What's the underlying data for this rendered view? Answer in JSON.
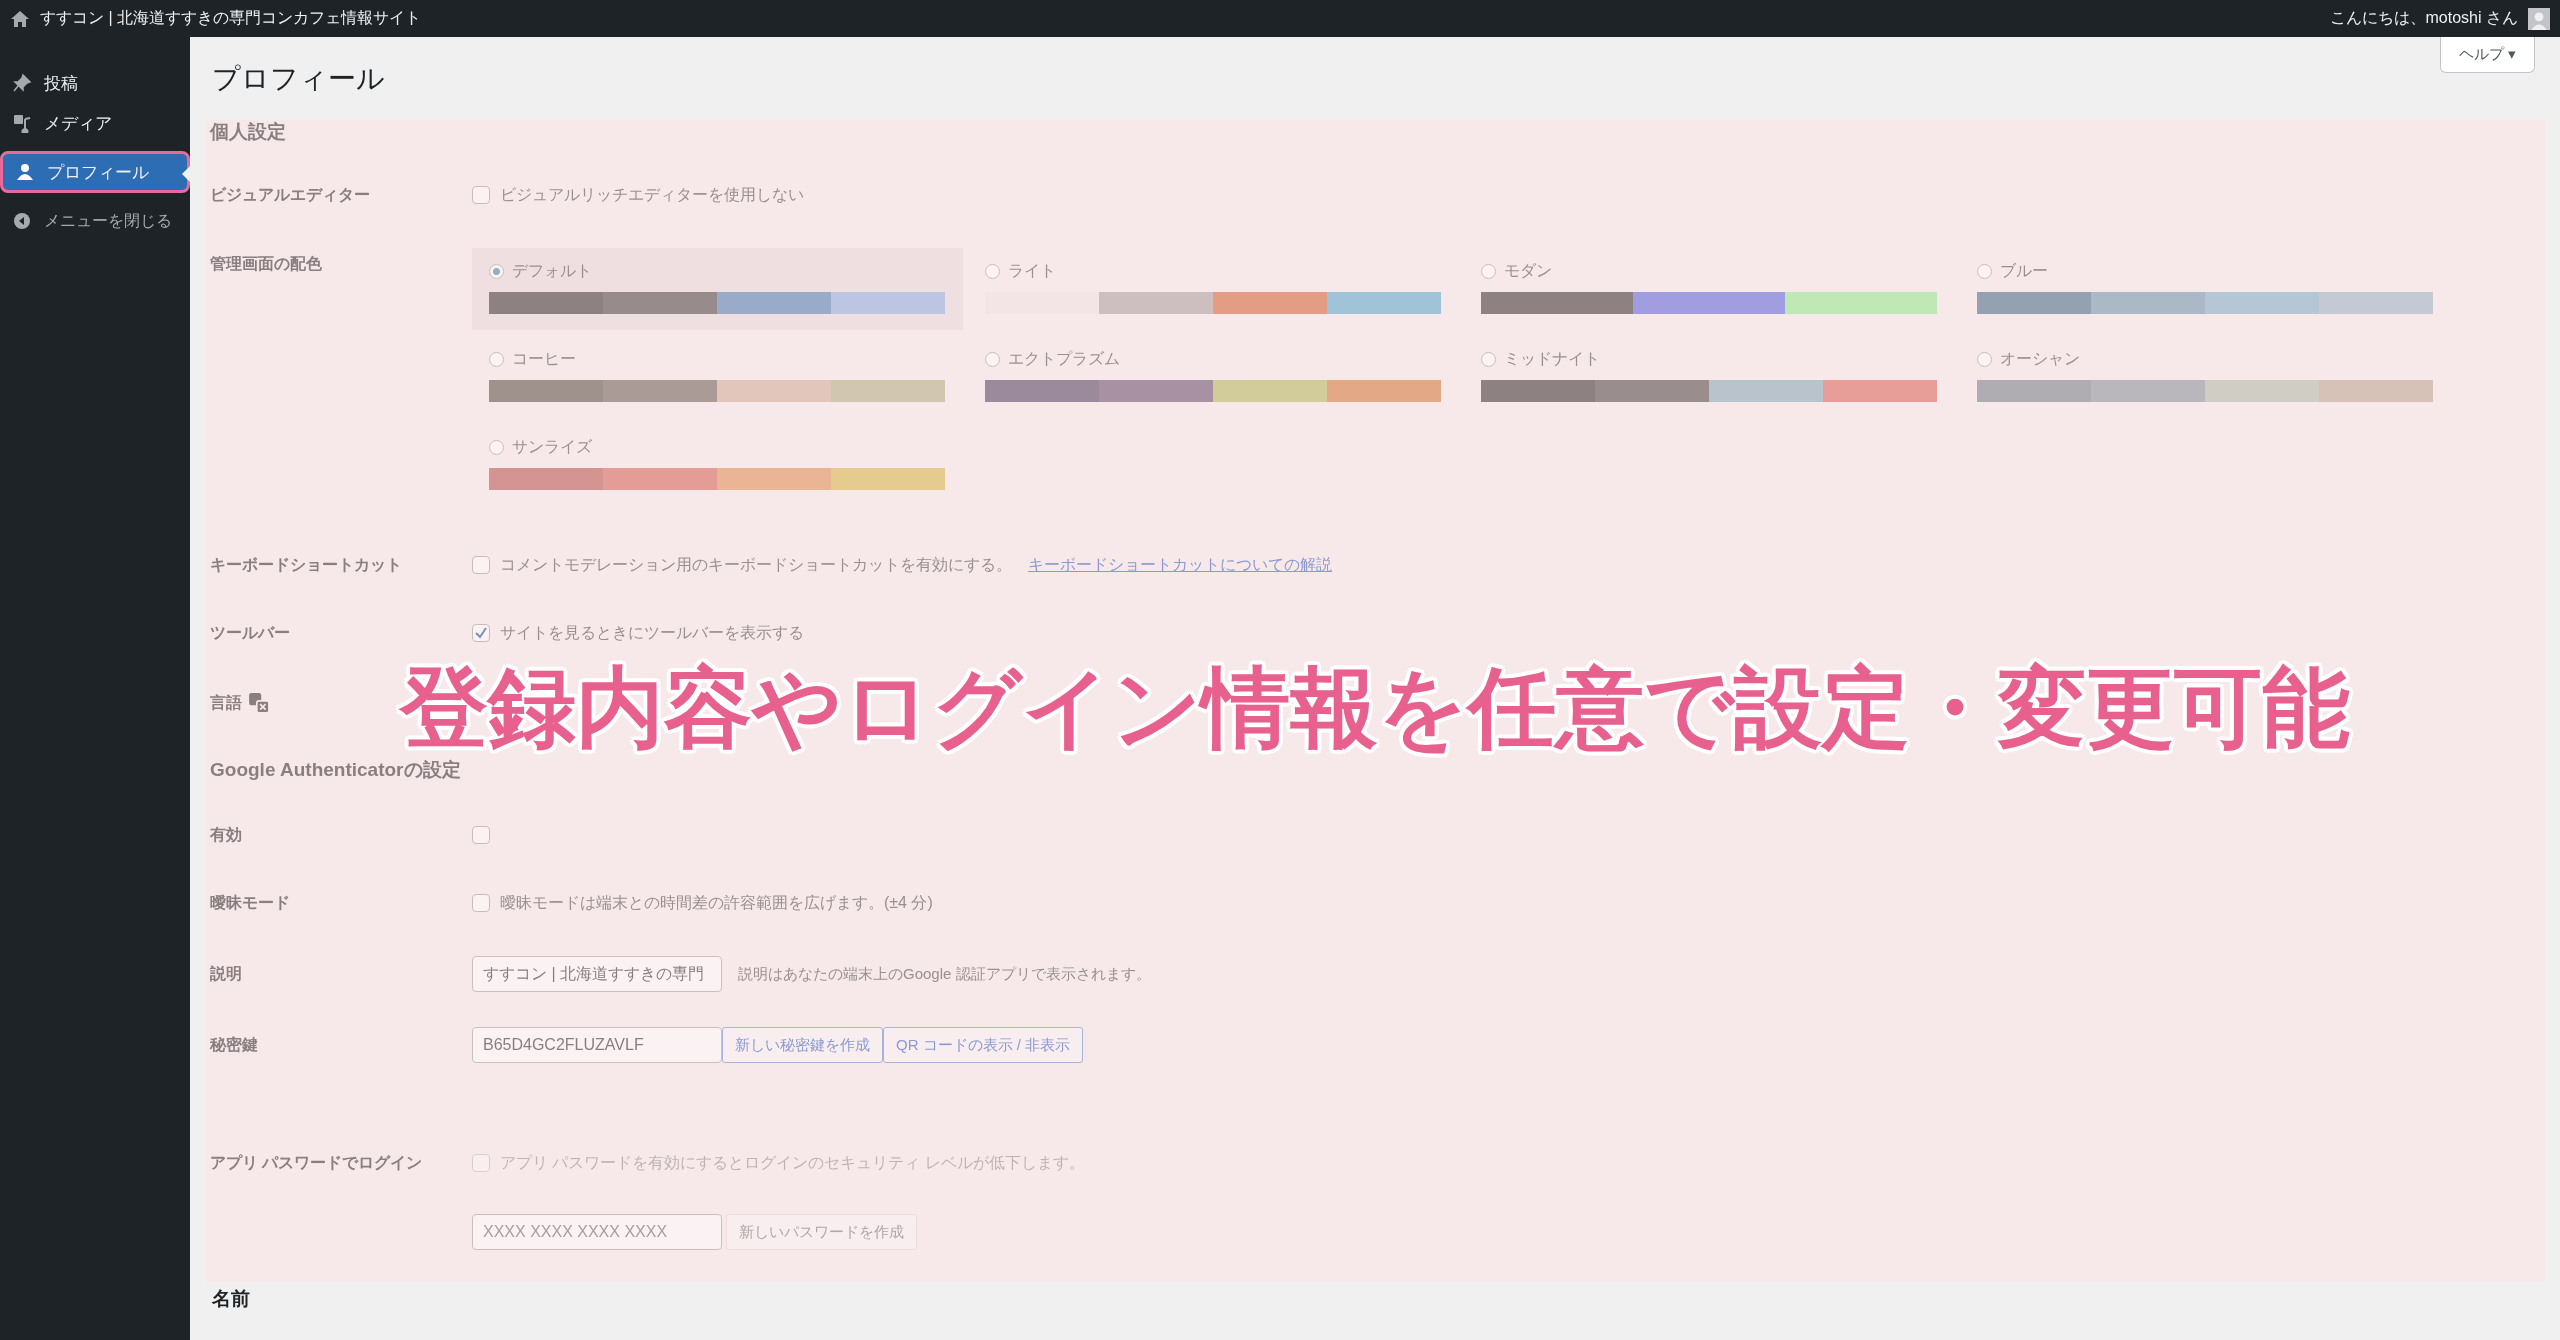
{
  "admin_bar": {
    "site_title": "すすコン | 北海道すすきの専門コンカフェ情報サイト",
    "greeting": "こんにちは、motoshi さん"
  },
  "sidebar": {
    "items": [
      {
        "label": "投稿",
        "kind": "pin",
        "selected": false
      },
      {
        "label": "メディア",
        "kind": "media",
        "selected": false
      },
      {
        "label": "プロフィール",
        "kind": "user",
        "selected": true
      },
      {
        "label": "メニューを閉じる",
        "kind": "collapse",
        "selected": false
      }
    ]
  },
  "help_button": "ヘルプ ▾",
  "page_title": "プロフィール",
  "personal_heading": "個人設定",
  "visual_editor": {
    "label": "ビジュアルエディター",
    "text": "ビジュアルリッチエディターを使用しない",
    "checked": false
  },
  "color_scheme": {
    "label": "管理画面の配色",
    "schemes": [
      {
        "name": "デフォルト",
        "selected": true,
        "swatches": [
          {
            "color": "#8d8182"
          },
          {
            "color": "#978b8b"
          },
          {
            "color": "#9aaac9"
          },
          {
            "color": "#bcc6e2"
          }
        ]
      },
      {
        "name": "ライト",
        "selected": false,
        "swatches": [
          {
            "color": "#f3e5e5"
          },
          {
            "color": "#cdbfbf"
          },
          {
            "color": "#e39d85"
          },
          {
            "color": "#a1c3d8"
          }
        ]
      },
      {
        "name": "モダン",
        "selected": false,
        "swatches": [
          {
            "color": "#8d8182"
          },
          {
            "color": "#a09de0"
          },
          {
            "color": "#bfe8b6"
          }
        ]
      },
      {
        "name": "ブルー",
        "selected": false,
        "swatches": [
          {
            "color": "#93a1b1"
          },
          {
            "color": "#abb8c6"
          },
          {
            "color": "#b5c7d7"
          },
          {
            "color": "#c3cad6"
          }
        ]
      },
      {
        "name": "コーヒー",
        "selected": false,
        "swatches": [
          {
            "color": "#9f918c"
          },
          {
            "color": "#ab9b97"
          },
          {
            "color": "#e2c6bb"
          },
          {
            "color": "#d1c6b0"
          }
        ]
      },
      {
        "name": "エクトプラズム",
        "selected": false,
        "swatches": [
          {
            "color": "#9b8a9b"
          },
          {
            "color": "#a891a3"
          },
          {
            "color": "#d2cb9a"
          },
          {
            "color": "#e3a987"
          }
        ]
      },
      {
        "name": "ミッドナイト",
        "selected": false,
        "swatches": [
          {
            "color": "#8d8182"
          },
          {
            "color": "#9a8d8d"
          },
          {
            "color": "#b9c3cc"
          },
          {
            "color": "#e89e98"
          }
        ]
      },
      {
        "name": "オーシャン",
        "selected": false,
        "swatches": [
          {
            "color": "#afadb1"
          },
          {
            "color": "#b9b7bb"
          },
          {
            "color": "#cfcdc4"
          },
          {
            "color": "#d6c2b7"
          }
        ]
      },
      {
        "name": "サンライズ",
        "selected": false,
        "swatches": [
          {
            "color": "#d39492"
          },
          {
            "color": "#e39c96"
          },
          {
            "color": "#eab594"
          },
          {
            "color": "#e6cb8f"
          }
        ]
      }
    ]
  },
  "keyboard_shortcuts": {
    "label": "キーボードショートカット",
    "text": "コメントモデレーション用のキーボードショートカットを有効にする。",
    "link": "キーボードショートカットについての解説",
    "checked": false
  },
  "toolbar": {
    "label": "ツールバー",
    "text": "サイトを見るときにツールバーを表示する",
    "checked": true
  },
  "language": {
    "label": "言語"
  },
  "google_auth": {
    "heading": "Google Authenticatorの設定",
    "enabled": {
      "label": "有効",
      "checked": false
    },
    "relaxed": {
      "label": "曖昧モード",
      "text": "曖昧モードは端末との時間差の許容範囲を広げます。(±4 分)",
      "checked": false
    },
    "description": {
      "label": "説明",
      "value": "すすコン | 北海道すすきの専門",
      "hint": "説明はあなたの端末上のGoogle 認証アプリで表示されます。"
    },
    "secret": {
      "label": "秘密鍵",
      "value": "B65D4GC2FLUZAVLF",
      "buttons": [
        "新しい秘密鍵を作成",
        "QR コードの表示 / 非表示"
      ]
    }
  },
  "app_password": {
    "label": "アプリ パスワードでログイン",
    "text": "アプリ パスワードを有効にするとログインのセキュリティ レベルが低下します。",
    "checked": false,
    "disabled": true,
    "placeholder": "XXXX XXXX XXXX XXXX",
    "button": "新しいパスワードを作成"
  },
  "name_heading": "名前",
  "caption": "登録内容やログイン情報を任意で設定・変更可能"
}
